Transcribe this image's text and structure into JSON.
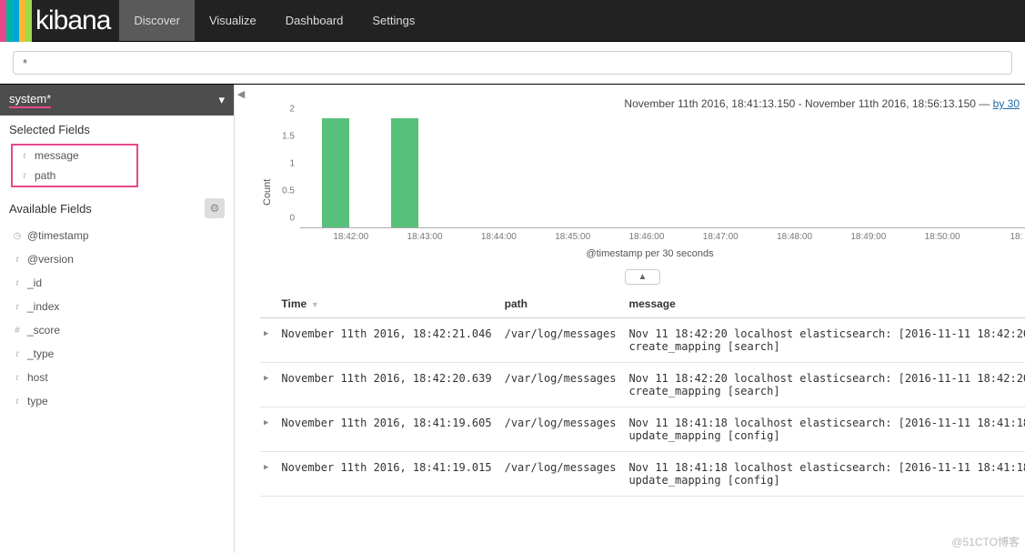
{
  "nav": {
    "brand": "kibana",
    "tabs": [
      {
        "label": "Discover",
        "active": true
      },
      {
        "label": "Visualize",
        "active": false
      },
      {
        "label": "Dashboard",
        "active": false
      },
      {
        "label": "Settings",
        "active": false
      }
    ]
  },
  "search": {
    "query": "*"
  },
  "sidebar": {
    "index_pattern": "system*",
    "selected_title": "Selected Fields",
    "selected_fields": [
      {
        "icon": "t",
        "name": "message"
      },
      {
        "icon": "t",
        "name": "path"
      }
    ],
    "available_title": "Available Fields",
    "available_fields": [
      {
        "icon": "clock",
        "name": "@timestamp"
      },
      {
        "icon": "t",
        "name": "@version"
      },
      {
        "icon": "t",
        "name": "_id"
      },
      {
        "icon": "t",
        "name": "_index"
      },
      {
        "icon": "#",
        "name": "_score"
      },
      {
        "icon": "t",
        "name": "_type"
      },
      {
        "icon": "t",
        "name": "host"
      },
      {
        "icon": "t",
        "name": "type"
      }
    ]
  },
  "timerange": {
    "from": "November 11th 2016, 18:41:13.150",
    "to": "November 11th 2016, 18:56:13.150",
    "link": "by 30"
  },
  "chart_data": {
    "type": "bar",
    "ylabel": "Count",
    "xlabel": "@timestamp per 30 seconds",
    "ylim": [
      0,
      2
    ],
    "yticks": [
      0,
      0.5,
      1,
      1.5,
      2
    ],
    "categories": [
      "18:42:00",
      "18:43:00",
      "18:44:00",
      "18:45:00",
      "18:46:00",
      "18:47:00",
      "18:48:00",
      "18:49:00",
      "18:50:00",
      "18:"
    ],
    "bars": [
      {
        "x_offset_pct": 3.0,
        "value": 2
      },
      {
        "x_offset_pct": 12.5,
        "value": 2
      }
    ]
  },
  "table": {
    "headers": {
      "time": "Time",
      "path": "path",
      "message": "message"
    },
    "rows": [
      {
        "time": "November 11th 2016, 18:42:21.046",
        "path": "/var/log/messages",
        "message": "Nov 11 18:42:20 localhost elasticsearch: [2016-11-11 18:42:20,2 create_mapping [search]"
      },
      {
        "time": "November 11th 2016, 18:42:20.639",
        "path": "/var/log/messages",
        "message": "Nov 11 18:42:20 localhost elasticsearch: [2016-11-11 18:42:20,2 create_mapping [search]"
      },
      {
        "time": "November 11th 2016, 18:41:19.605",
        "path": "/var/log/messages",
        "message": "Nov 11 18:41:18 localhost elasticsearch: [2016-11-11 18:41:18,6 update_mapping [config]"
      },
      {
        "time": "November 11th 2016, 18:41:19.015",
        "path": "/var/log/messages",
        "message": "Nov 11 18:41:18 localhost elasticsearch: [2016-11-11 18:41:18,6 update_mapping [config]"
      }
    ]
  },
  "watermark": "@51CTO博客"
}
